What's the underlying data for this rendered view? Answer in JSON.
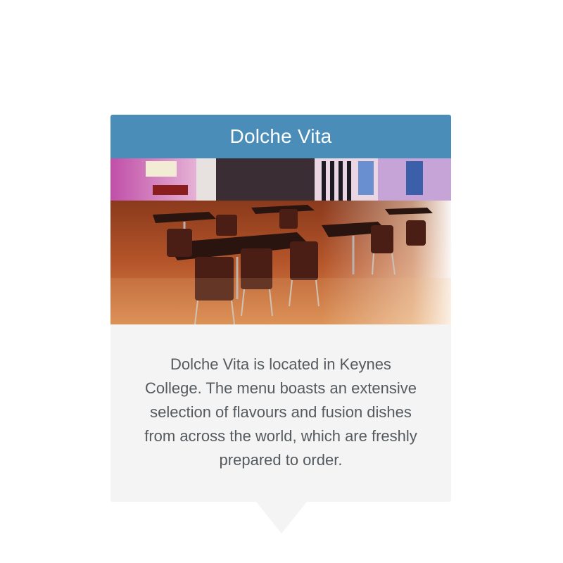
{
  "card": {
    "title": "Dolche Vita",
    "image_alt": "Dolche Vita dining area with tables and chairs",
    "description": "Dolche Vita is located in Keynes College. The menu boasts an extensive selection of flavours and fusion dishes from across the world, which are freshly prepared to order."
  },
  "colors": {
    "header_bg": "#4a8db9",
    "body_bg": "#f4f4f4",
    "text": "#555a5e"
  }
}
